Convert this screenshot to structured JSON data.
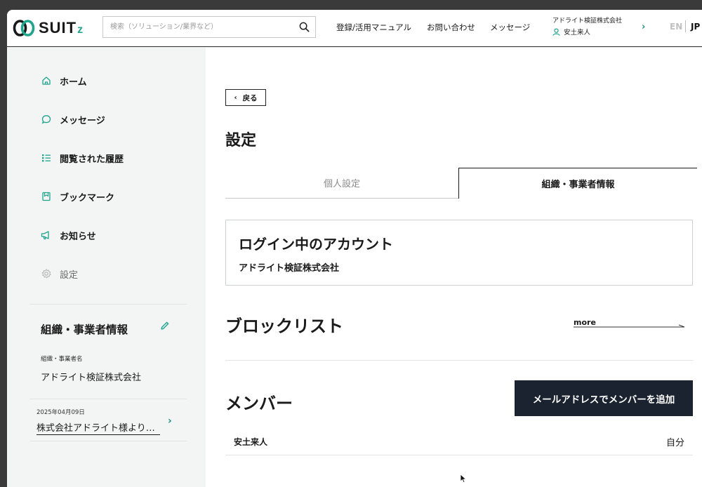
{
  "header": {
    "logo_text": "SUIT",
    "logo_suffix": "z",
    "search_placeholder": "検索（ソリューション/業界など）",
    "nav": [
      {
        "label": "登録/活用マニュアル"
      },
      {
        "label": "お問い合わせ"
      },
      {
        "label": "メッセージ"
      }
    ],
    "company_name": "アドライト検証株式会社",
    "user_name": "安土来人",
    "lang_en": "EN",
    "lang_jp": "JP"
  },
  "sidebar": {
    "items": [
      {
        "label": "ホーム",
        "icon": "home-icon"
      },
      {
        "label": "メッセージ",
        "icon": "message-icon"
      },
      {
        "label": "閲覧された履歴",
        "icon": "history-icon"
      },
      {
        "label": "ブックマーク",
        "icon": "bookmark-icon"
      },
      {
        "label": "お知らせ",
        "icon": "megaphone-icon"
      },
      {
        "label": "設定",
        "icon": "gear-icon"
      }
    ],
    "org_title": "組織・事業者情報",
    "org_label": "組織・事業者名",
    "org_value": "アドライト検証株式会社",
    "notice_date": "2025年04月09日",
    "notice_title": "株式会社アドライト様よりメッセージが届きました"
  },
  "main": {
    "back_label": "戻る",
    "page_title": "設定",
    "tabs": [
      {
        "label": "個人設定",
        "active": false
      },
      {
        "label": "組織・事業者情報",
        "active": true
      }
    ],
    "account_title": "ログイン中のアカウント",
    "account_value": "アドライト検証株式会社",
    "block_title": "ブロックリスト",
    "more_label": "more",
    "member_title": "メンバー",
    "add_member_label": "メールアドレスでメンバーを追加",
    "members": [
      {
        "name": "安土来人",
        "role": "自分"
      }
    ]
  },
  "colors": {
    "accent": "#1fa58c",
    "button_dark": "#1b2330",
    "sidebar_bg": "#f3f4f4"
  }
}
